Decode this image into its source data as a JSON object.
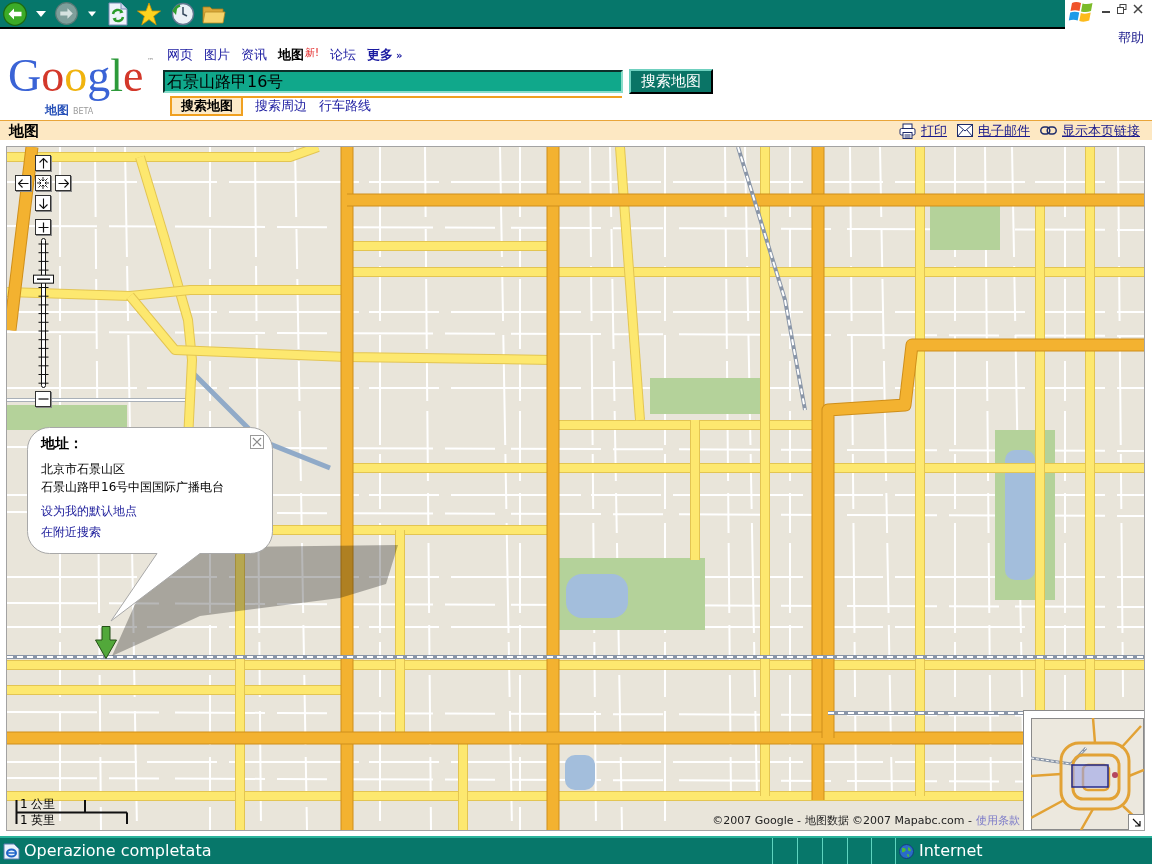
{
  "help_link": "帮助",
  "logo": {
    "wordmark": "Google",
    "trademark": "™",
    "product": "地图",
    "badge": "BETA"
  },
  "nav": [
    {
      "label": "网页",
      "selected": false,
      "kind": "link"
    },
    {
      "label": "图片",
      "selected": false,
      "kind": "link"
    },
    {
      "label": "资讯",
      "selected": false,
      "kind": "link"
    },
    {
      "label": "地图",
      "selected": true,
      "kind": "link",
      "badge": "新!"
    },
    {
      "label": "论坛",
      "selected": false,
      "kind": "link"
    },
    {
      "label": "更多",
      "selected": false,
      "kind": "more",
      "suffix": "»"
    }
  ],
  "search": {
    "value": "石景山路甲16号",
    "button": "搜索地图"
  },
  "search_tabs": [
    {
      "label": "搜索地图",
      "selected": true
    },
    {
      "label": "搜索周边",
      "selected": false
    },
    {
      "label": "行车路线",
      "selected": false
    }
  ],
  "section_bar": {
    "title": "地图",
    "actions": [
      {
        "label": "打印",
        "kind": "print"
      },
      {
        "label": "电子邮件",
        "kind": "email"
      },
      {
        "label": "显示本页链接",
        "kind": "link"
      }
    ]
  },
  "map": {
    "zoom": {
      "level": 0.74
    },
    "info_window": {
      "title": "地址：",
      "lines": [
        "北京市石景山区",
        "石景山路甲16号中国国际广播电台"
      ],
      "links": [
        "设为我的默认地点",
        "在附近搜索"
      ]
    },
    "scale": [
      "1 公里",
      "1 英里"
    ],
    "copyright": "©2007 Google - 地图数据 ©2007 Mapabc.com -",
    "terms_link": "使用条款"
  },
  "status_bar": {
    "text": "Operazione completata",
    "zone": "Internet"
  }
}
